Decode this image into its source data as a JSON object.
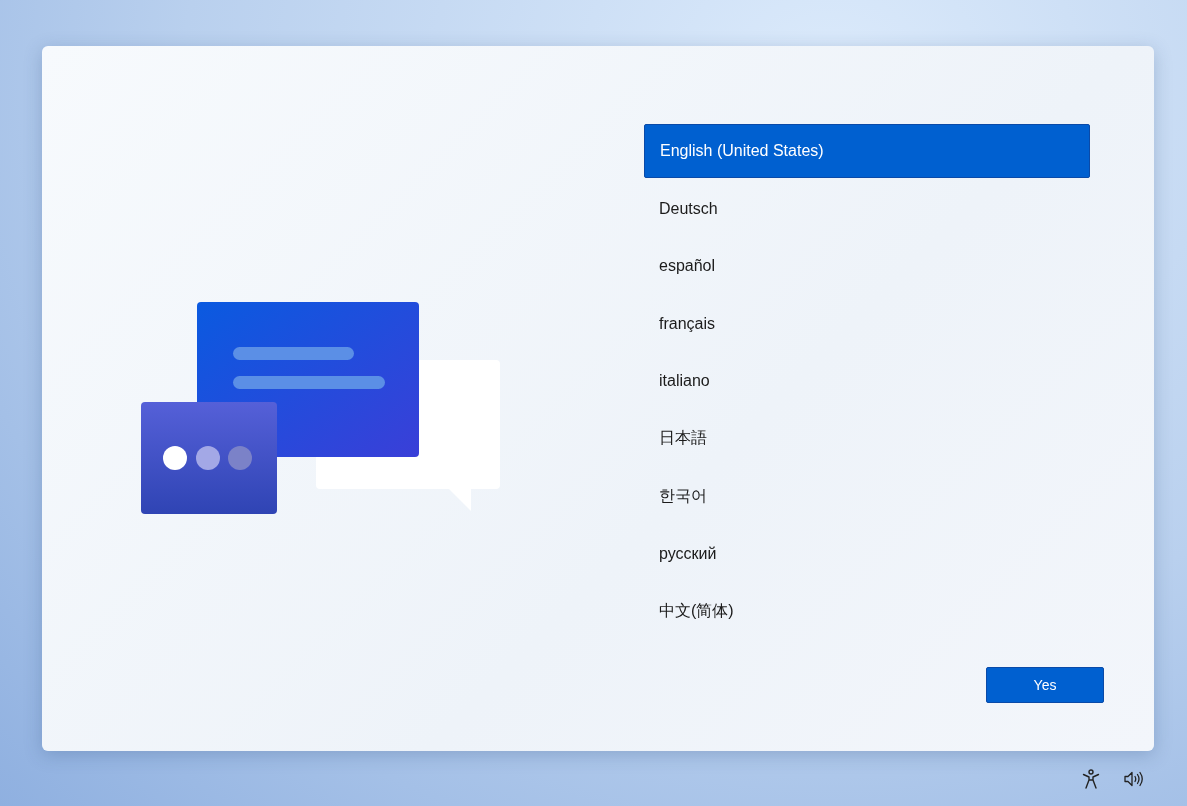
{
  "languages": [
    {
      "label": "English (United States)",
      "selected": true
    },
    {
      "label": "Deutsch",
      "selected": false
    },
    {
      "label": "español",
      "selected": false
    },
    {
      "label": "français",
      "selected": false
    },
    {
      "label": "italiano",
      "selected": false
    },
    {
      "label": "日本語",
      "selected": false
    },
    {
      "label": "한국어",
      "selected": false
    },
    {
      "label": "русский",
      "selected": false
    },
    {
      "label": "中文(简体)",
      "selected": false
    }
  ],
  "confirm_button": {
    "label": "Yes"
  }
}
